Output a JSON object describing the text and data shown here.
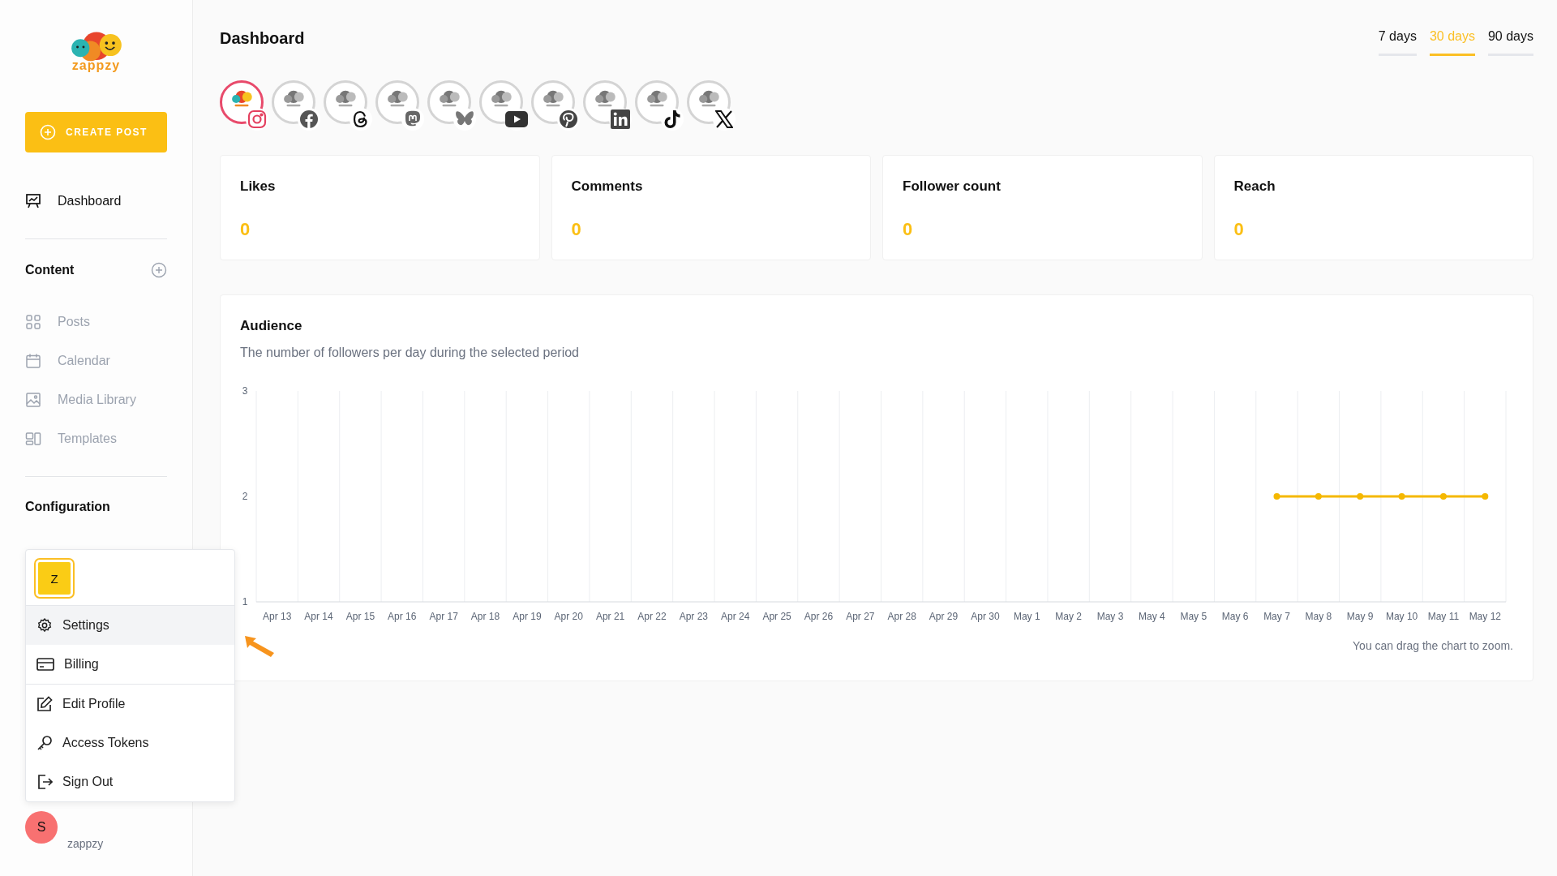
{
  "sidebar": {
    "logo_text": "zappzy",
    "create_button": "CREATE POST",
    "main_item": {
      "label": "Dashboard",
      "selected": true
    },
    "sections": [
      {
        "title": "Content",
        "add_button": true,
        "items": [
          {
            "label": "Posts",
            "selected": false
          },
          {
            "label": "Calendar",
            "selected": false
          },
          {
            "label": "Media Library",
            "selected": false
          },
          {
            "label": "Templates",
            "selected": false
          }
        ]
      },
      {
        "title": "Configuration",
        "add_button": false
      }
    ],
    "user": {
      "avatar": "S",
      "name": "zappzy"
    }
  },
  "account_menu": {
    "avatar": "Z",
    "items": [
      {
        "label": "Settings",
        "selected": true,
        "divider_before": false
      },
      {
        "label": "Billing",
        "selected": false,
        "divider_before": false
      },
      {
        "label": "Edit Profile",
        "selected": false,
        "divider_before": true
      },
      {
        "label": "Access Tokens",
        "selected": false,
        "divider_before": false
      },
      {
        "label": "Sign Out",
        "selected": false,
        "divider_before": false
      }
    ]
  },
  "page": {
    "title": "Dashboard",
    "periods": [
      {
        "label": "7 days",
        "selected": false
      },
      {
        "label": "30 days",
        "selected": true
      },
      {
        "label": "90 days",
        "selected": false
      }
    ],
    "accounts": [
      {
        "kind": "instagram",
        "selected": true
      },
      {
        "kind": "facebook",
        "selected": false
      },
      {
        "kind": "threads",
        "selected": false
      },
      {
        "kind": "mastodon",
        "selected": false
      },
      {
        "kind": "bluesky",
        "selected": false
      },
      {
        "kind": "youtube",
        "selected": false
      },
      {
        "kind": "pinterest",
        "selected": false
      },
      {
        "kind": "linkedin",
        "selected": false
      },
      {
        "kind": "tiktok",
        "selected": false
      },
      {
        "kind": "x",
        "selected": false
      }
    ],
    "stats": [
      {
        "label": "Likes",
        "value": "0"
      },
      {
        "label": "Comments",
        "value": "0"
      },
      {
        "label": "Follower count",
        "value": "0"
      },
      {
        "label": "Reach",
        "value": "0"
      }
    ],
    "audience": {
      "title": "Audience",
      "subtitle": "The number of followers per day during the selected period",
      "hint": "You can drag the chart to zoom.",
      "chart_data": {
        "type": "line",
        "categories": [
          "Apr 13",
          "Apr 14",
          "Apr 15",
          "Apr 16",
          "Apr 17",
          "Apr 18",
          "Apr 19",
          "Apr 20",
          "Apr 21",
          "Apr 22",
          "Apr 23",
          "Apr 24",
          "Apr 25",
          "Apr 26",
          "Apr 27",
          "Apr 28",
          "Apr 29",
          "Apr 30",
          "May 1",
          "May 2",
          "May 3",
          "May 4",
          "May 5",
          "May 6",
          "May 7",
          "May 8",
          "May 9",
          "May 10",
          "May 11",
          "May 12"
        ],
        "series": [
          {
            "color": "#f5b800",
            "marker": "circle",
            "values": [
              null,
              null,
              null,
              null,
              null,
              null,
              null,
              null,
              null,
              null,
              null,
              null,
              null,
              null,
              null,
              null,
              null,
              null,
              null,
              null,
              null,
              null,
              null,
              null,
              2,
              2,
              2,
              2,
              2,
              2
            ]
          }
        ],
        "ylim": [
          1,
          3
        ],
        "yticks": [
          1,
          2,
          3
        ]
      }
    }
  }
}
